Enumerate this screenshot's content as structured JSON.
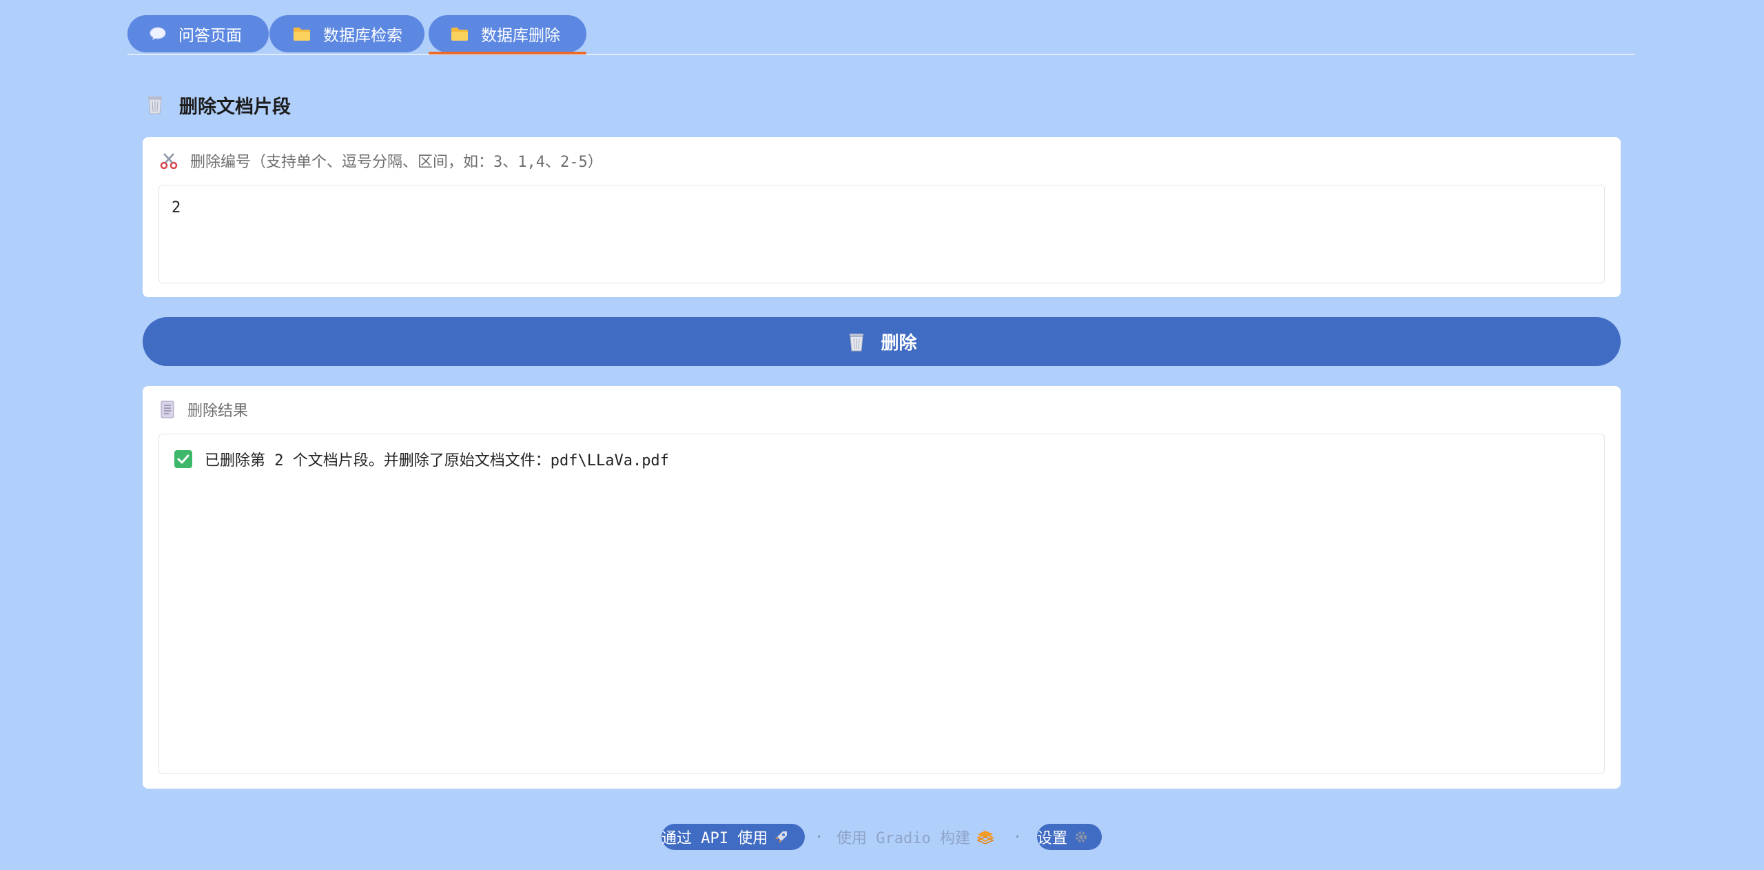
{
  "tabs": [
    {
      "label": "问答页面",
      "icon": "speech-bubble-icon",
      "selected": false
    },
    {
      "label": "数据库检索",
      "icon": "folder-icon",
      "selected": false
    },
    {
      "label": "数据库删除",
      "icon": "folder-icon",
      "selected": true
    }
  ],
  "section": {
    "title": "删除文档片段",
    "icon": "wastebasket-icon"
  },
  "delete_input": {
    "label": "删除编号（支持单个、逗号分隔、区间，如：3、1,4、2-5）",
    "icon": "scissors-icon",
    "value": "2"
  },
  "delete_button": {
    "label": "删除",
    "icon": "wastebasket-icon"
  },
  "result": {
    "label": "删除结果",
    "icon": "page-icon",
    "message": "已删除第 2 个文档片段。并删除了原始文档文件：pdf\\LLaVa.pdf",
    "status_icon": "check-mark-icon"
  },
  "footer": {
    "api_label": "通过 API 使用",
    "gradio_label": "使用 Gradio 构建",
    "settings_label": "设置",
    "separator": "·"
  },
  "colors": {
    "background": "#b1cffb",
    "tab": "#5c88e2",
    "primary_button": "#416cc3",
    "tab_underline": "#e86b2a",
    "success": "#3db86b"
  }
}
